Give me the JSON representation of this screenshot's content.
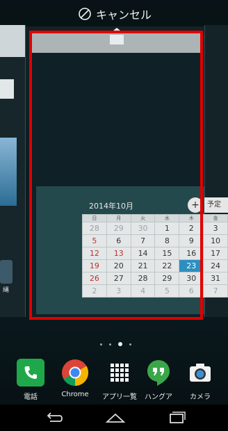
{
  "topbar": {
    "cancel_label": "キャンセル",
    "cancel_icon": "cancel-icon"
  },
  "left_page": {
    "app_label": "縄"
  },
  "calendar": {
    "month_title": "2014年10月",
    "add_label": "+",
    "schedule_label": "予定",
    "weekday_headers": [
      "日",
      "月",
      "火",
      "水",
      "木",
      "金"
    ],
    "rows": [
      [
        "28",
        "29",
        "30",
        "1",
        "2",
        "3"
      ],
      [
        "5",
        "6",
        "7",
        "8",
        "9",
        "10"
      ],
      [
        "12",
        "13",
        "14",
        "15",
        "16",
        "17"
      ],
      [
        "19",
        "20",
        "21",
        "22",
        "23",
        "24"
      ],
      [
        "26",
        "27",
        "28",
        "29",
        "30",
        "31"
      ],
      [
        "2",
        "3",
        "4",
        "5",
        "6",
        "7"
      ]
    ]
  },
  "dock": {
    "apps": [
      {
        "label": "電話",
        "icon": "phone-icon",
        "color": "#1fa84a"
      },
      {
        "label": "Chrome",
        "icon": "chrome-icon",
        "color": "#db4437"
      },
      {
        "label": "アプリ一覧",
        "icon": "app-drawer-icon",
        "color": "#ffffff"
      },
      {
        "label": "ハングア",
        "icon": "hangouts-icon",
        "color": "#3aa64a"
      },
      {
        "label": "カメラ",
        "icon": "camera-icon",
        "color": "#ffffff"
      }
    ]
  },
  "colors": {
    "selection_frame": "#e00000",
    "today_highlight": "#2d8fc0",
    "sunday": "#c03030"
  }
}
